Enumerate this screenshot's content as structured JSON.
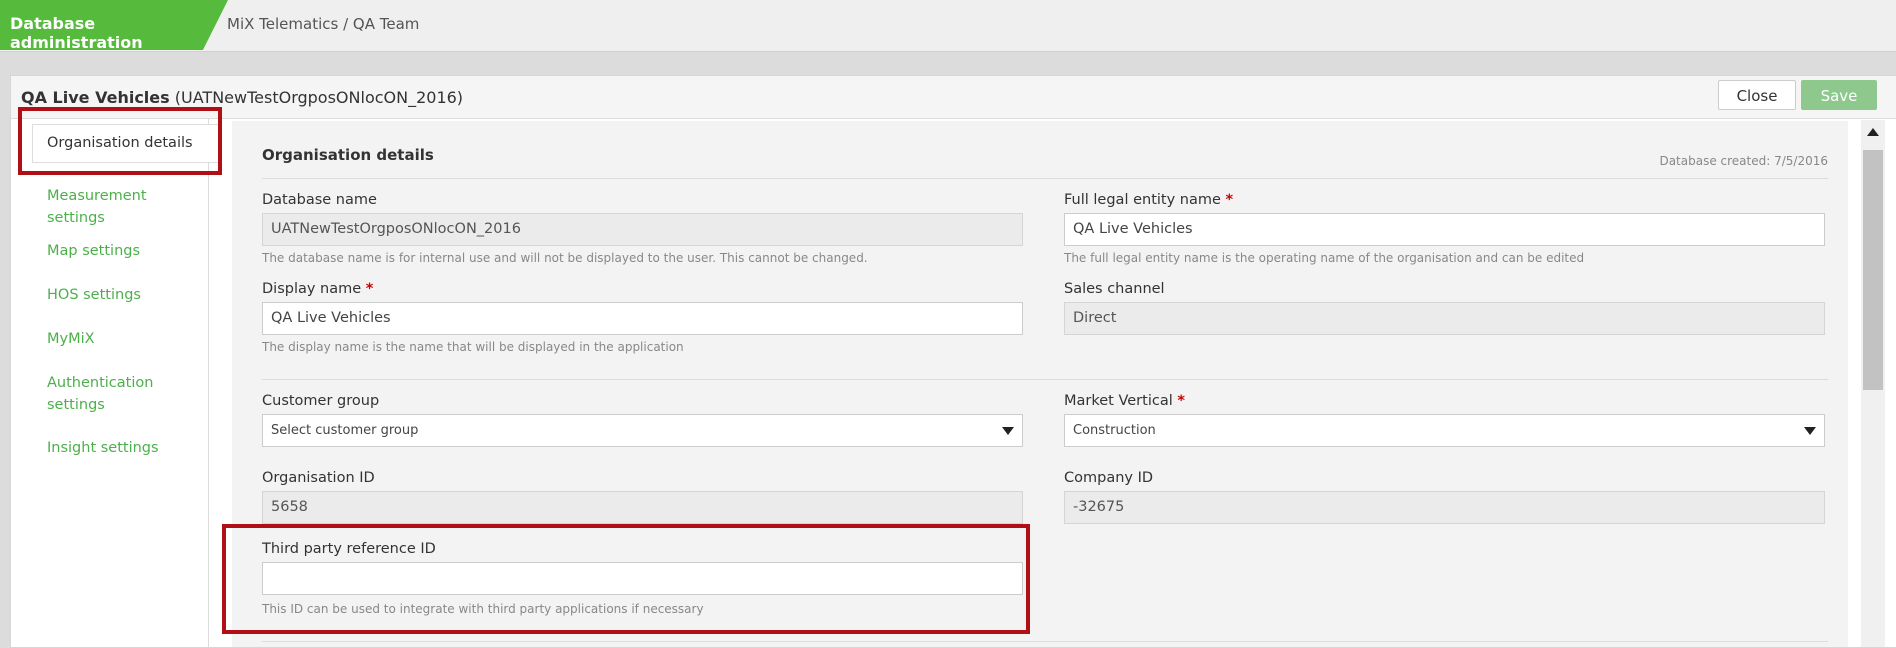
{
  "topbar": {
    "app_title": "Database administration",
    "breadcrumb": "MiX Telematics / QA Team"
  },
  "header": {
    "title_bold": "QA Live Vehicles",
    "title_suffix": "(UATNewTestOrgposONlocON_2016)",
    "close_label": "Close",
    "save_label": "Save"
  },
  "sidebar": {
    "active": "Organisation details",
    "items": [
      "Measurement settings",
      "Map settings",
      "HOS settings",
      "MyMiX",
      "Authentication settings",
      "Insight settings"
    ]
  },
  "section": {
    "title": "Organisation details",
    "db_created": "Database created: 7/5/2016"
  },
  "form": {
    "database_name": {
      "label": "Database name",
      "value": "UATNewTestOrgposONlocON_2016",
      "hint": "The database name is for internal use and will not be displayed to the user. This cannot be changed."
    },
    "legal_name": {
      "label": "Full legal entity name",
      "required": "*",
      "value": "QA Live Vehicles",
      "hint": "The full legal entity name is the operating name of the organisation and can be edited"
    },
    "display_name": {
      "label": "Display name",
      "required": "*",
      "value": "QA Live Vehicles",
      "hint": "The display name is the name that will be displayed in the application"
    },
    "sales_channel": {
      "label": "Sales channel",
      "value": "Direct"
    },
    "customer_group": {
      "label": "Customer group",
      "value": "Select customer group"
    },
    "market_vertical": {
      "label": "Market Vertical",
      "required": "*",
      "value": "Construction"
    },
    "organisation_id": {
      "label": "Organisation ID",
      "value": "5658"
    },
    "company_id": {
      "label": "Company ID",
      "value": "-32675"
    },
    "third_party_id": {
      "label": "Third party reference ID",
      "value": "",
      "hint": "This ID can be used to integrate with third party applications if necessary"
    }
  },
  "colors": {
    "brand_green": "#56ba3c",
    "link_green": "#4cb04a",
    "save_green": "#8ec88d",
    "highlight_red": "#b00f16",
    "required_red": "#cc0000"
  }
}
